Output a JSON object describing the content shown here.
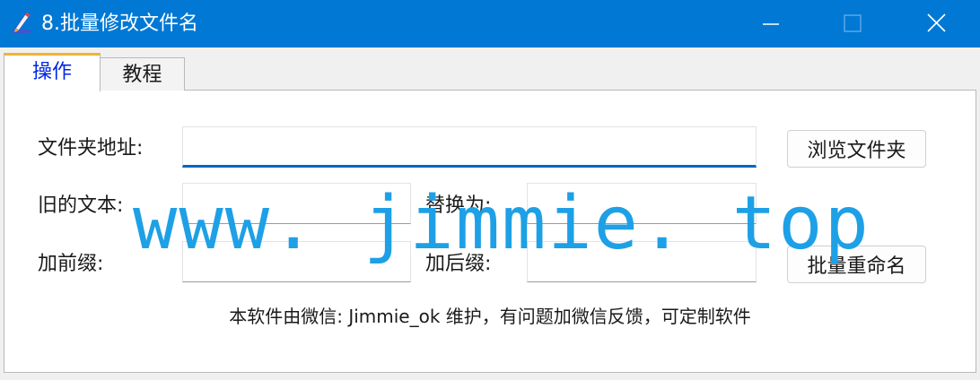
{
  "window": {
    "title": "8.批量修改文件名"
  },
  "tabs": [
    {
      "label": "操作"
    },
    {
      "label": "教程"
    }
  ],
  "form": {
    "folder_label": "文件夹地址:",
    "folder_value": "",
    "browse_button": "浏览文件夹",
    "old_text_label": "旧的文本:",
    "old_text_value": "",
    "replace_label": "替换为:",
    "replace_value": "",
    "prefix_label": "加前缀:",
    "prefix_value": "",
    "suffix_label": "加后缀:",
    "suffix_value": "",
    "rename_button": "批量重命名"
  },
  "footer": {
    "text": "本软件由微信: Jimmie_ok 维护，有问题加微信反馈，可定制软件"
  },
  "watermark": {
    "text": "www. jimmie. top"
  },
  "colors": {
    "titlebar": "#0078d4",
    "active_tab_text": "#0026e6",
    "watermark": "#1ea0e6",
    "focus_underline": "#0067c0"
  }
}
